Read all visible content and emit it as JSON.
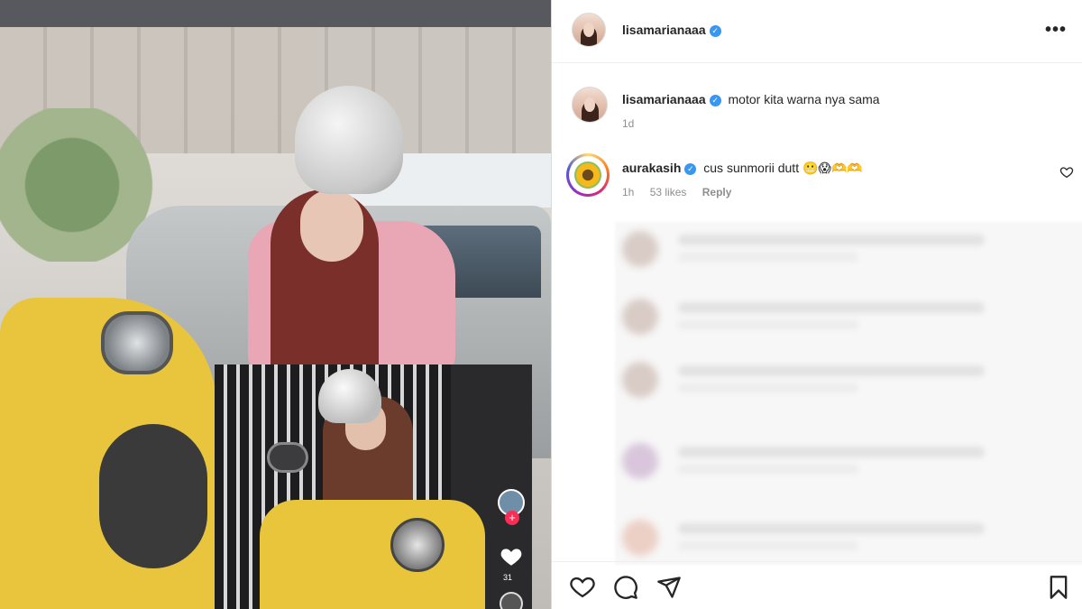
{
  "post": {
    "author": "lisamarianaaa",
    "caption_author": "lisamarianaaa",
    "caption_text": "motor kita warna nya sama",
    "caption_time": "1d",
    "verified_mark": "✓"
  },
  "comment": {
    "author": "aurakasih",
    "text": "cus sunmorii dutt 😬😱🫶🫶",
    "time": "1h",
    "likes": "53 likes",
    "reply": "Reply"
  },
  "icons": {
    "more": "more-options-icon",
    "like": "heart-icon",
    "comment": "comment-icon",
    "share": "share-icon",
    "save": "bookmark-icon"
  },
  "inset": {
    "plus": "+",
    "like_count": "31"
  },
  "colors": {
    "verified": "#3897f0",
    "text": "#262626",
    "muted": "#8e8e8e",
    "tiktok_red": "#fe2c55"
  }
}
